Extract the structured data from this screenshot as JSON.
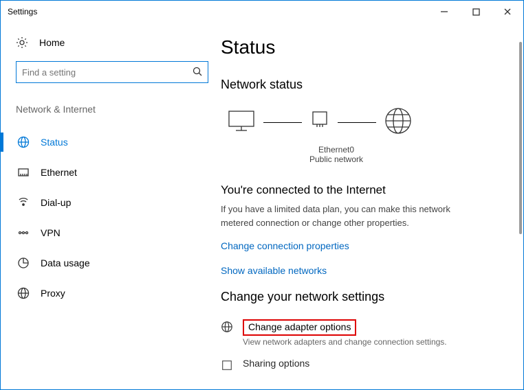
{
  "window": {
    "title": "Settings"
  },
  "sidebar": {
    "home": "Home",
    "search_placeholder": "Find a setting",
    "group": "Network & Internet",
    "items": [
      {
        "label": "Status"
      },
      {
        "label": "Ethernet"
      },
      {
        "label": "Dial-up"
      },
      {
        "label": "VPN"
      },
      {
        "label": "Data usage"
      },
      {
        "label": "Proxy"
      }
    ]
  },
  "main": {
    "title": "Status",
    "network_status": "Network status",
    "adapter_name": "Ethernet0",
    "adapter_profile": "Public network",
    "connected_heading": "You're connected to the Internet",
    "connected_desc": "If you have a limited data plan, you can make this network metered connection or change other properties.",
    "link_change_props": "Change connection properties",
    "link_show_networks": "Show available networks",
    "change_settings_heading": "Change your network settings",
    "adapter_options": {
      "title": "Change adapter options",
      "desc": "View network adapters and change connection settings."
    },
    "sharing_options": {
      "title": "Sharing options"
    }
  }
}
